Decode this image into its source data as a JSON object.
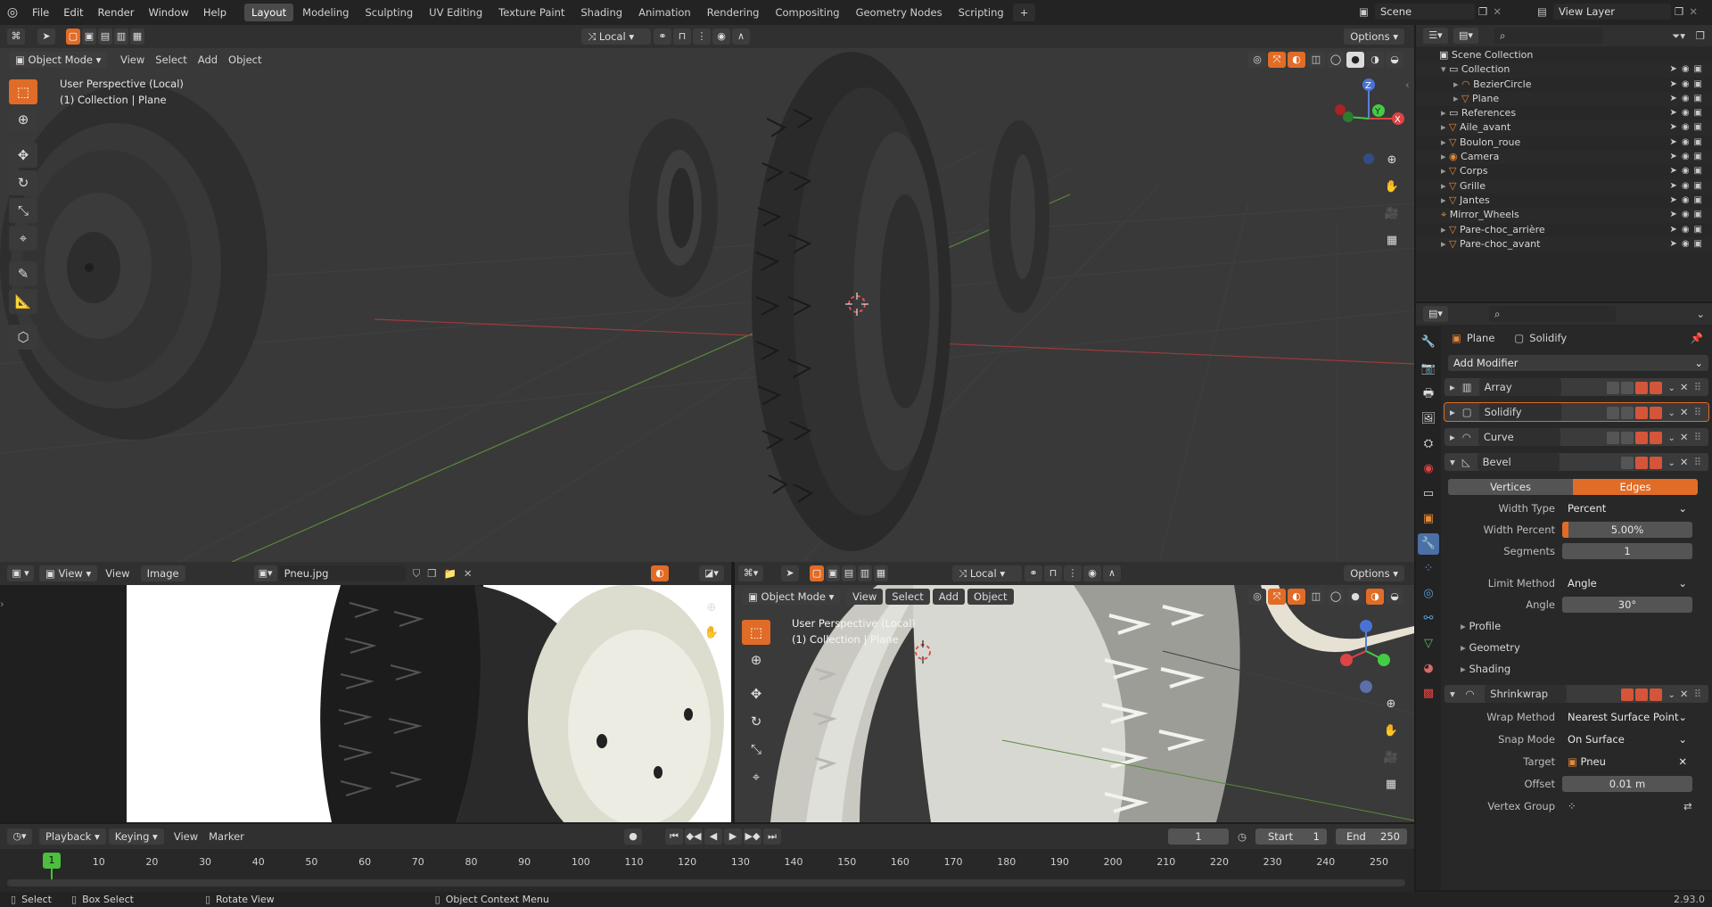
{
  "topbar": {
    "menu": [
      "File",
      "Edit",
      "Render",
      "Window",
      "Help"
    ],
    "workspaces": [
      "Layout",
      "Modeling",
      "Sculpting",
      "UV Editing",
      "Texture Paint",
      "Shading",
      "Animation",
      "Rendering",
      "Compositing",
      "Geometry Nodes",
      "Scripting"
    ],
    "active_workspace": "Layout",
    "plus": "+",
    "scene": "Scene",
    "view_layer": "View Layer"
  },
  "viewport": {
    "mode": "Object Mode",
    "menu": [
      "View",
      "Select",
      "Add",
      "Object"
    ],
    "orientation": "Local",
    "options": "Options",
    "info_line1": "User Perspective (Local)",
    "info_line2": "(1) Collection | Plane",
    "gizmo": {
      "x": "X",
      "y": "Y",
      "z": "Z"
    }
  },
  "image_editor": {
    "view_dd": "View",
    "menu": [
      "View",
      "Image"
    ],
    "image_name": "Pneu.jpg"
  },
  "viewport2": {
    "orientation": "Local",
    "options": "Options",
    "mode": "Object Mode",
    "menu": [
      "View",
      "Select",
      "Add",
      "Object"
    ],
    "info_line1": "User Perspective (Local)",
    "info_line2": "(1) Collection | Plane"
  },
  "timeline": {
    "playback": "Playback",
    "keying": "Keying",
    "menu": [
      "View",
      "Marker"
    ],
    "current_frame": "1",
    "start_label": "Start",
    "start": "1",
    "end_label": "End",
    "end": "250",
    "ticks": [
      "1",
      "10",
      "20",
      "30",
      "40",
      "50",
      "60",
      "70",
      "80",
      "90",
      "100",
      "110",
      "120",
      "130",
      "140",
      "150",
      "160",
      "170",
      "180",
      "190",
      "200",
      "210",
      "220",
      "230",
      "240",
      "250"
    ]
  },
  "statusbar": {
    "select": "Select",
    "box_select": "Box Select",
    "rotate_view": "Rotate View",
    "context_menu": "Object Context Menu",
    "version": "2.93.0"
  },
  "outliner": {
    "root": "Scene Collection",
    "rows": [
      {
        "label": "Collection",
        "indent": 1,
        "icon": "collection-icon"
      },
      {
        "label": "BezierCircle",
        "indent": 2,
        "icon": "curve-icon"
      },
      {
        "label": "Plane",
        "indent": 2,
        "icon": "mesh-icon"
      },
      {
        "label": "References",
        "indent": 1,
        "icon": "collection-icon"
      },
      {
        "label": "Aile_avant",
        "indent": 1,
        "icon": "mesh-icon"
      },
      {
        "label": "Boulon_roue",
        "indent": 1,
        "icon": "mesh-icon"
      },
      {
        "label": "Camera",
        "indent": 1,
        "icon": "camera-icon"
      },
      {
        "label": "Corps",
        "indent": 1,
        "icon": "mesh-icon"
      },
      {
        "label": "Grille",
        "indent": 1,
        "icon": "mesh-icon"
      },
      {
        "label": "Jantes",
        "indent": 1,
        "icon": "mesh-icon"
      },
      {
        "label": "Mirror_Wheels",
        "indent": 1,
        "icon": "empty-icon"
      },
      {
        "label": "Pare-choc_arrière",
        "indent": 1,
        "icon": "mesh-icon"
      },
      {
        "label": "Pare-choc_avant",
        "indent": 1,
        "icon": "mesh-icon"
      }
    ]
  },
  "properties": {
    "breadcrumb_object": "Plane",
    "breadcrumb_modifier": "Solidify",
    "add_modifier": "Add Modifier",
    "modifiers": [
      {
        "name": "Array",
        "expanded": false,
        "active": false
      },
      {
        "name": "Solidify",
        "expanded": false,
        "active": true
      },
      {
        "name": "Curve",
        "expanded": false,
        "active": false
      },
      {
        "name": "Bevel",
        "expanded": true,
        "active": false
      }
    ],
    "bevel": {
      "vertices": "Vertices",
      "edges": "Edges",
      "width_type_label": "Width Type",
      "width_type": "Percent",
      "width_percent_label": "Width Percent",
      "width_percent": "5.00%",
      "segments_label": "Segments",
      "segments": "1",
      "limit_method_label": "Limit Method",
      "limit_method": "Angle",
      "angle_label": "Angle",
      "angle": "30°",
      "subpanels": [
        "Profile",
        "Geometry",
        "Shading"
      ]
    },
    "shrinkwrap": {
      "name": "Shrinkwrap",
      "wrap_method_label": "Wrap Method",
      "wrap_method": "Nearest Surface Point",
      "snap_mode_label": "Snap Mode",
      "snap_mode": "On Surface",
      "target_label": "Target",
      "target": "Pneu",
      "offset_label": "Offset",
      "offset": "0.01 m",
      "vertex_group_label": "Vertex Group"
    }
  },
  "colors": {
    "accent": "#e06c27",
    "background": "#1d1d1d",
    "panel": "#303030",
    "viewport": "#393939"
  }
}
